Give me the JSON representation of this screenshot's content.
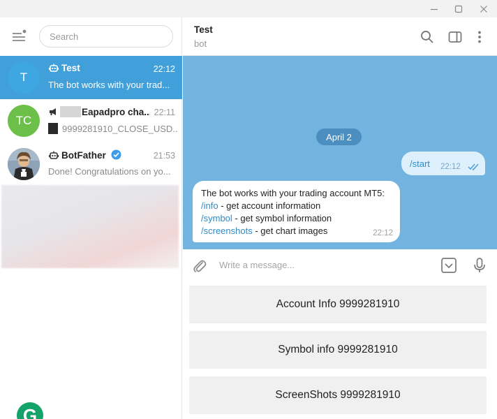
{
  "window": {
    "minimize_glyph": "—",
    "maximize_glyph": "☐",
    "close_glyph": "✕"
  },
  "sidebar": {
    "search_placeholder": "Search",
    "chats": [
      {
        "title": "Test",
        "time": "22:12",
        "preview": "The bot works with your trad...",
        "avatar_text": "T",
        "avatar_color": "#3ea6e0",
        "active": true,
        "icon": "bot-icon"
      },
      {
        "title": "Eapadpro cha...",
        "time": "22:11",
        "preview": "9999281910_CLOSE_USD...",
        "avatar_text": "TC",
        "avatar_color": "#6cc04a",
        "active": false,
        "icon": "channel-icon"
      },
      {
        "title": "BotFather",
        "time": "21:53",
        "preview": "Done! Congratulations on yo...",
        "avatar_text": "",
        "avatar_color": "#7b8fa3",
        "active": false,
        "icon": "bot-icon"
      }
    ]
  },
  "chat": {
    "title": "Test",
    "subtitle": "bot",
    "date": "April 2",
    "outgoing": {
      "text": "/start",
      "time": "22:12"
    },
    "incoming": {
      "line1": "The bot works with your trading account MT5:",
      "line2_cmd": "/info",
      "line2_text": " - get account information",
      "line3_cmd": "/symbol",
      "line3_text": " - get symbol information",
      "line4_cmd": "/screenshots",
      "line4_text": " - get chart images",
      "time": "22:12"
    },
    "composer_placeholder": "Write a message...",
    "keyboard": [
      "Account Info 9999281910",
      "Symbol info 9999281910",
      "ScreenShots 9999281910"
    ]
  },
  "colors": {
    "accent": "#419fd9",
    "chat_background": "#72b3e0",
    "date_pill": "#4b8fc1",
    "outgoing_bubble": "#dff0fd",
    "link": "#2f8bc8"
  },
  "grammarly": {
    "letter": "G"
  }
}
